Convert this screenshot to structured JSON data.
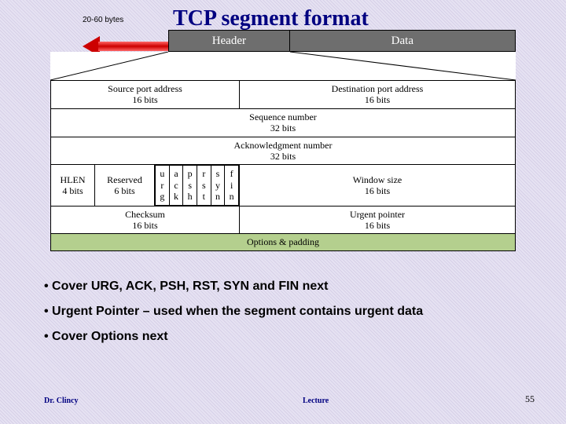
{
  "title": "TCP segment format",
  "bytes_label": "20-60 bytes",
  "top": {
    "header": "Header",
    "data": "Data"
  },
  "rows": {
    "src_port": "Source port address\n16 bits",
    "dst_port": "Destination port address\n16 bits",
    "seq": "Sequence number\n32 bits",
    "ack": "Acknowledgment number\n32 bits",
    "hlen": "HLEN\n4 bits",
    "reserved": "Reserved\n6 bits",
    "flags": {
      "urg": "u\nr\ng",
      "ack": "a\nc\nk",
      "psh": "p\ns\nh",
      "rst": "r\ns\nt",
      "syn": "s\ny\nn",
      "fin": "f\ni\nn"
    },
    "window": "Window size\n16 bits",
    "checksum": "Checksum\n16 bits",
    "urgent": "Urgent pointer\n16 bits",
    "options": "Options & padding"
  },
  "bullets": [
    "Cover URG, ACK, PSH, RST, SYN and FIN next",
    "Urgent Pointer – used when the segment contains urgent data",
    "Cover Options next"
  ],
  "footer": {
    "left": "Dr. Clincy",
    "center": "Lecture",
    "right": "55"
  }
}
